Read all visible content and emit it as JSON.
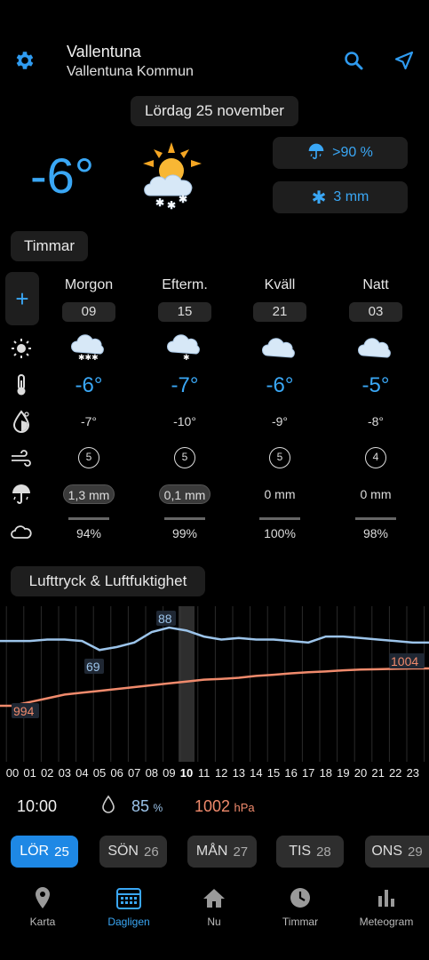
{
  "header": {
    "location": "Vallentuna",
    "municipality": "Vallentuna Kommun",
    "date": "Lördag 25 november"
  },
  "current": {
    "temp": "-6°",
    "precip_prob": ">90 %",
    "snow_amount": "3 mm"
  },
  "hours_section": {
    "title": "Timmar",
    "add_label": "+",
    "periods": [
      {
        "name": "Morgon",
        "hour": "09",
        "temp": "-6°",
        "feels": "-7°",
        "wind": "5",
        "precip": "1,3 mm",
        "precip_has": true,
        "cloud": "94%"
      },
      {
        "name": "Efterm.",
        "hour": "15",
        "temp": "-7°",
        "feels": "-10°",
        "wind": "5",
        "precip": "0,1 mm",
        "precip_has": true,
        "cloud": "99%"
      },
      {
        "name": "Kväll",
        "hour": "21",
        "temp": "-6°",
        "feels": "-9°",
        "wind": "5",
        "precip": "0 mm",
        "precip_has": false,
        "cloud": "100%"
      },
      {
        "name": "Natt",
        "hour": "03",
        "temp": "-5°",
        "feels": "-8°",
        "wind": "4",
        "precip": "0 mm",
        "precip_has": false,
        "cloud": "98%"
      }
    ]
  },
  "pressure_section": {
    "title": "Lufttryck & Luftfuktighet"
  },
  "chart_data": {
    "type": "line",
    "x": [
      "00",
      "01",
      "02",
      "03",
      "04",
      "05",
      "06",
      "07",
      "08",
      "09",
      "10",
      "11",
      "12",
      "13",
      "14",
      "15",
      "16",
      "17",
      "18",
      "19",
      "20",
      "21",
      "22",
      "23"
    ],
    "selected_x": "10",
    "series": [
      {
        "name": "",
        "color": "#9cc4ea",
        "values": [
          79,
          79,
          80,
          80,
          79,
          73,
          75,
          78,
          85,
          88,
          86,
          82,
          80,
          81,
          80,
          80,
          79,
          78,
          82,
          82,
          81,
          80,
          79,
          78
        ]
      },
      {
        "name": "",
        "color": "#f08a6c",
        "values": [
          994,
          995,
          996,
          997,
          997.5,
          998,
          998.5,
          999,
          999.5,
          1000,
          1000.5,
          1001,
          1001.2,
          1001.5,
          1002,
          1002.3,
          1002.7,
          1003,
          1003.2,
          1003.5,
          1003.7,
          1003.8,
          1003.9,
          1004
        ]
      }
    ],
    "annotations": {
      "humidity_max": "88",
      "humidity_min": "69",
      "pressure_min": "994",
      "pressure_max": "1004"
    }
  },
  "readout": {
    "time": "10:00",
    "humidity": "85",
    "humidity_unit": "%",
    "pressure": "1002",
    "pressure_unit": "hPa"
  },
  "days": [
    {
      "name": "LÖR",
      "num": "25",
      "active": true
    },
    {
      "name": "SÖN",
      "num": "26",
      "active": false
    },
    {
      "name": "MÅN",
      "num": "27",
      "active": false
    },
    {
      "name": "TIS",
      "num": "28",
      "active": false
    },
    {
      "name": "ONS",
      "num": "29",
      "active": false
    }
  ],
  "nav": [
    {
      "label": "Karta",
      "icon": "map-pin-icon"
    },
    {
      "label": "Dagligen",
      "icon": "calendar-icon"
    },
    {
      "label": "Nu",
      "icon": "home-icon"
    },
    {
      "label": "Timmar",
      "icon": "clock-icon"
    },
    {
      "label": "Meteogram",
      "icon": "bar-chart-icon"
    }
  ],
  "colors": {
    "accent": "#3aa7f5",
    "active_day": "#1e88e5",
    "pressure": "#f08a6c",
    "humidity": "#9cc4ea"
  }
}
